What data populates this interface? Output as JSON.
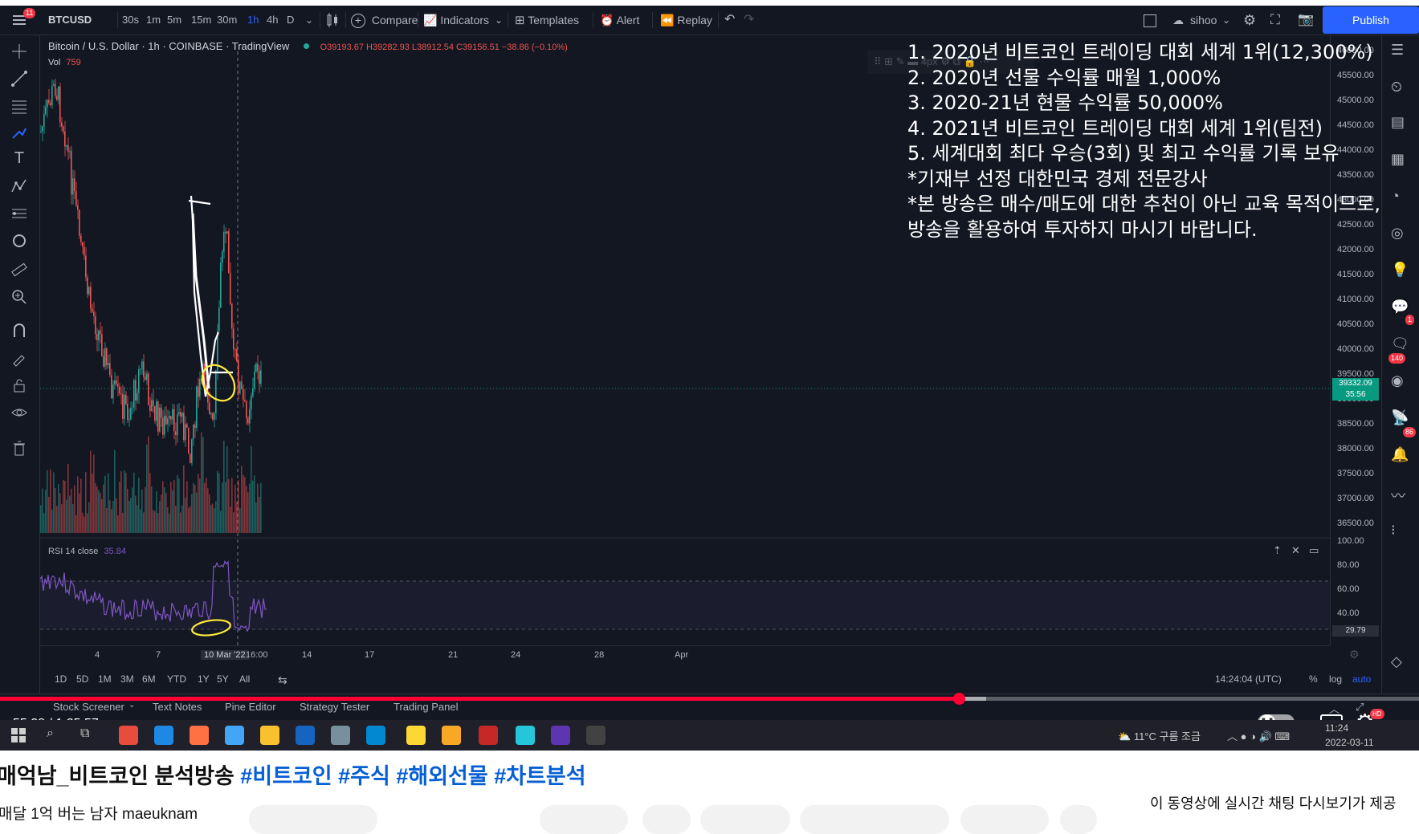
{
  "toolbar": {
    "symbol": "BTCUSD",
    "intervals": [
      "30s",
      "1m",
      "5m",
      "15m",
      "30m",
      "1h",
      "4h",
      "D"
    ],
    "active_interval": "1h",
    "compare_label": "Compare",
    "indicators_label": "Indicators",
    "templates_label": "Templates",
    "alert_label": "Alert",
    "replay_label": "Replay",
    "user_label": "sihoo",
    "publish_label": "Publish",
    "menu_badge": "11"
  },
  "legend": {
    "title": "Bitcoin / U.S. Dollar · 1h · COINBASE · TradingView",
    "ohlc": "O39193.67 H39282.93 L38912.54 C39156.51 −38.86 (−0.10%)",
    "vol_label": "Vol",
    "vol_value": "759",
    "rsi_label": "RSI 14 close",
    "rsi_value": "35.84"
  },
  "price_scale": {
    "ticks": [
      "46000.00",
      "45500.00",
      "45000.00",
      "44500.00",
      "44000.00",
      "43500.00",
      "43000.00",
      "42500.00",
      "42000.00",
      "41500.00",
      "41000.00",
      "40500.00",
      "40000.00",
      "39500.00",
      "39000.00",
      "38500.00",
      "38000.00",
      "37500.00",
      "37000.00",
      "36500.00"
    ],
    "current_price": "39332.09",
    "countdown": "35:56",
    "rsi_ticks": [
      "100.00",
      "80.00",
      "60.00",
      "40.00"
    ],
    "rsi_current": "29.79"
  },
  "overlay_text": [
    "1. 2020년 비트코인 트레이딩 대회 세계 1위(12,300%)",
    "2. 2020년 선물 수익률 매월 1,000%",
    "3. 2020-21년 현물 수익률 50,000%",
    "4. 2021년 비트코인 트레이딩 대회 세계 1위(팀전)",
    "5. 세계대회 최다 우승(3회) 및 최고 수익률 기록 보유",
    "*기재부 선정 대한민국 경제 전문강사",
    "*본 방송은 매수/매도에 대한 추천이 아닌 교육 목적이므로,",
    " 방송을 활용하여 투자하지 마시기 바랍니다."
  ],
  "time_axis": {
    "ticks": [
      "4",
      "7",
      "10 Mar '22",
      "16:00",
      "14",
      "17",
      "21",
      "24",
      "28",
      "Apr"
    ]
  },
  "ranges": {
    "items": [
      "1D",
      "5D",
      "1M",
      "3M",
      "6M",
      "YTD",
      "1Y",
      "5Y",
      "All"
    ],
    "clock": "14:24:04 (UTC)",
    "percent": "%",
    "log": "log",
    "auto": "auto"
  },
  "bottom_tabs": [
    "Stock Screener",
    "Text Notes",
    "Pine Editor",
    "Strategy Tester",
    "Trading Panel"
  ],
  "right_badges": [
    "1",
    "140",
    "86"
  ],
  "player": {
    "timecode": "55:28 / 1:25:57",
    "progress": 0.676,
    "buffered": 0.695,
    "hd_badge": "HD"
  },
  "taskbar": {
    "weather": "11°C 구름 조금",
    "time": "11:24",
    "date": "2022-03-11"
  },
  "youtube": {
    "title_prefix": "매억남_비트코인 분석방송 ",
    "hashtags": "#비트코인 #주식 #해외선물 #차트분석",
    "channel": "매달 1억 버는 남자 maeuknam",
    "chat_note": "이 동영상에 실시간 채팅 다시보기가 제공"
  },
  "colors": {
    "bg": "#131722",
    "up": "#26a69a",
    "down": "#ef5350",
    "accent": "#2962ff",
    "rsi": "#7e57c2",
    "highlight": "#ffeb3b",
    "progress": "#ff0033"
  }
}
